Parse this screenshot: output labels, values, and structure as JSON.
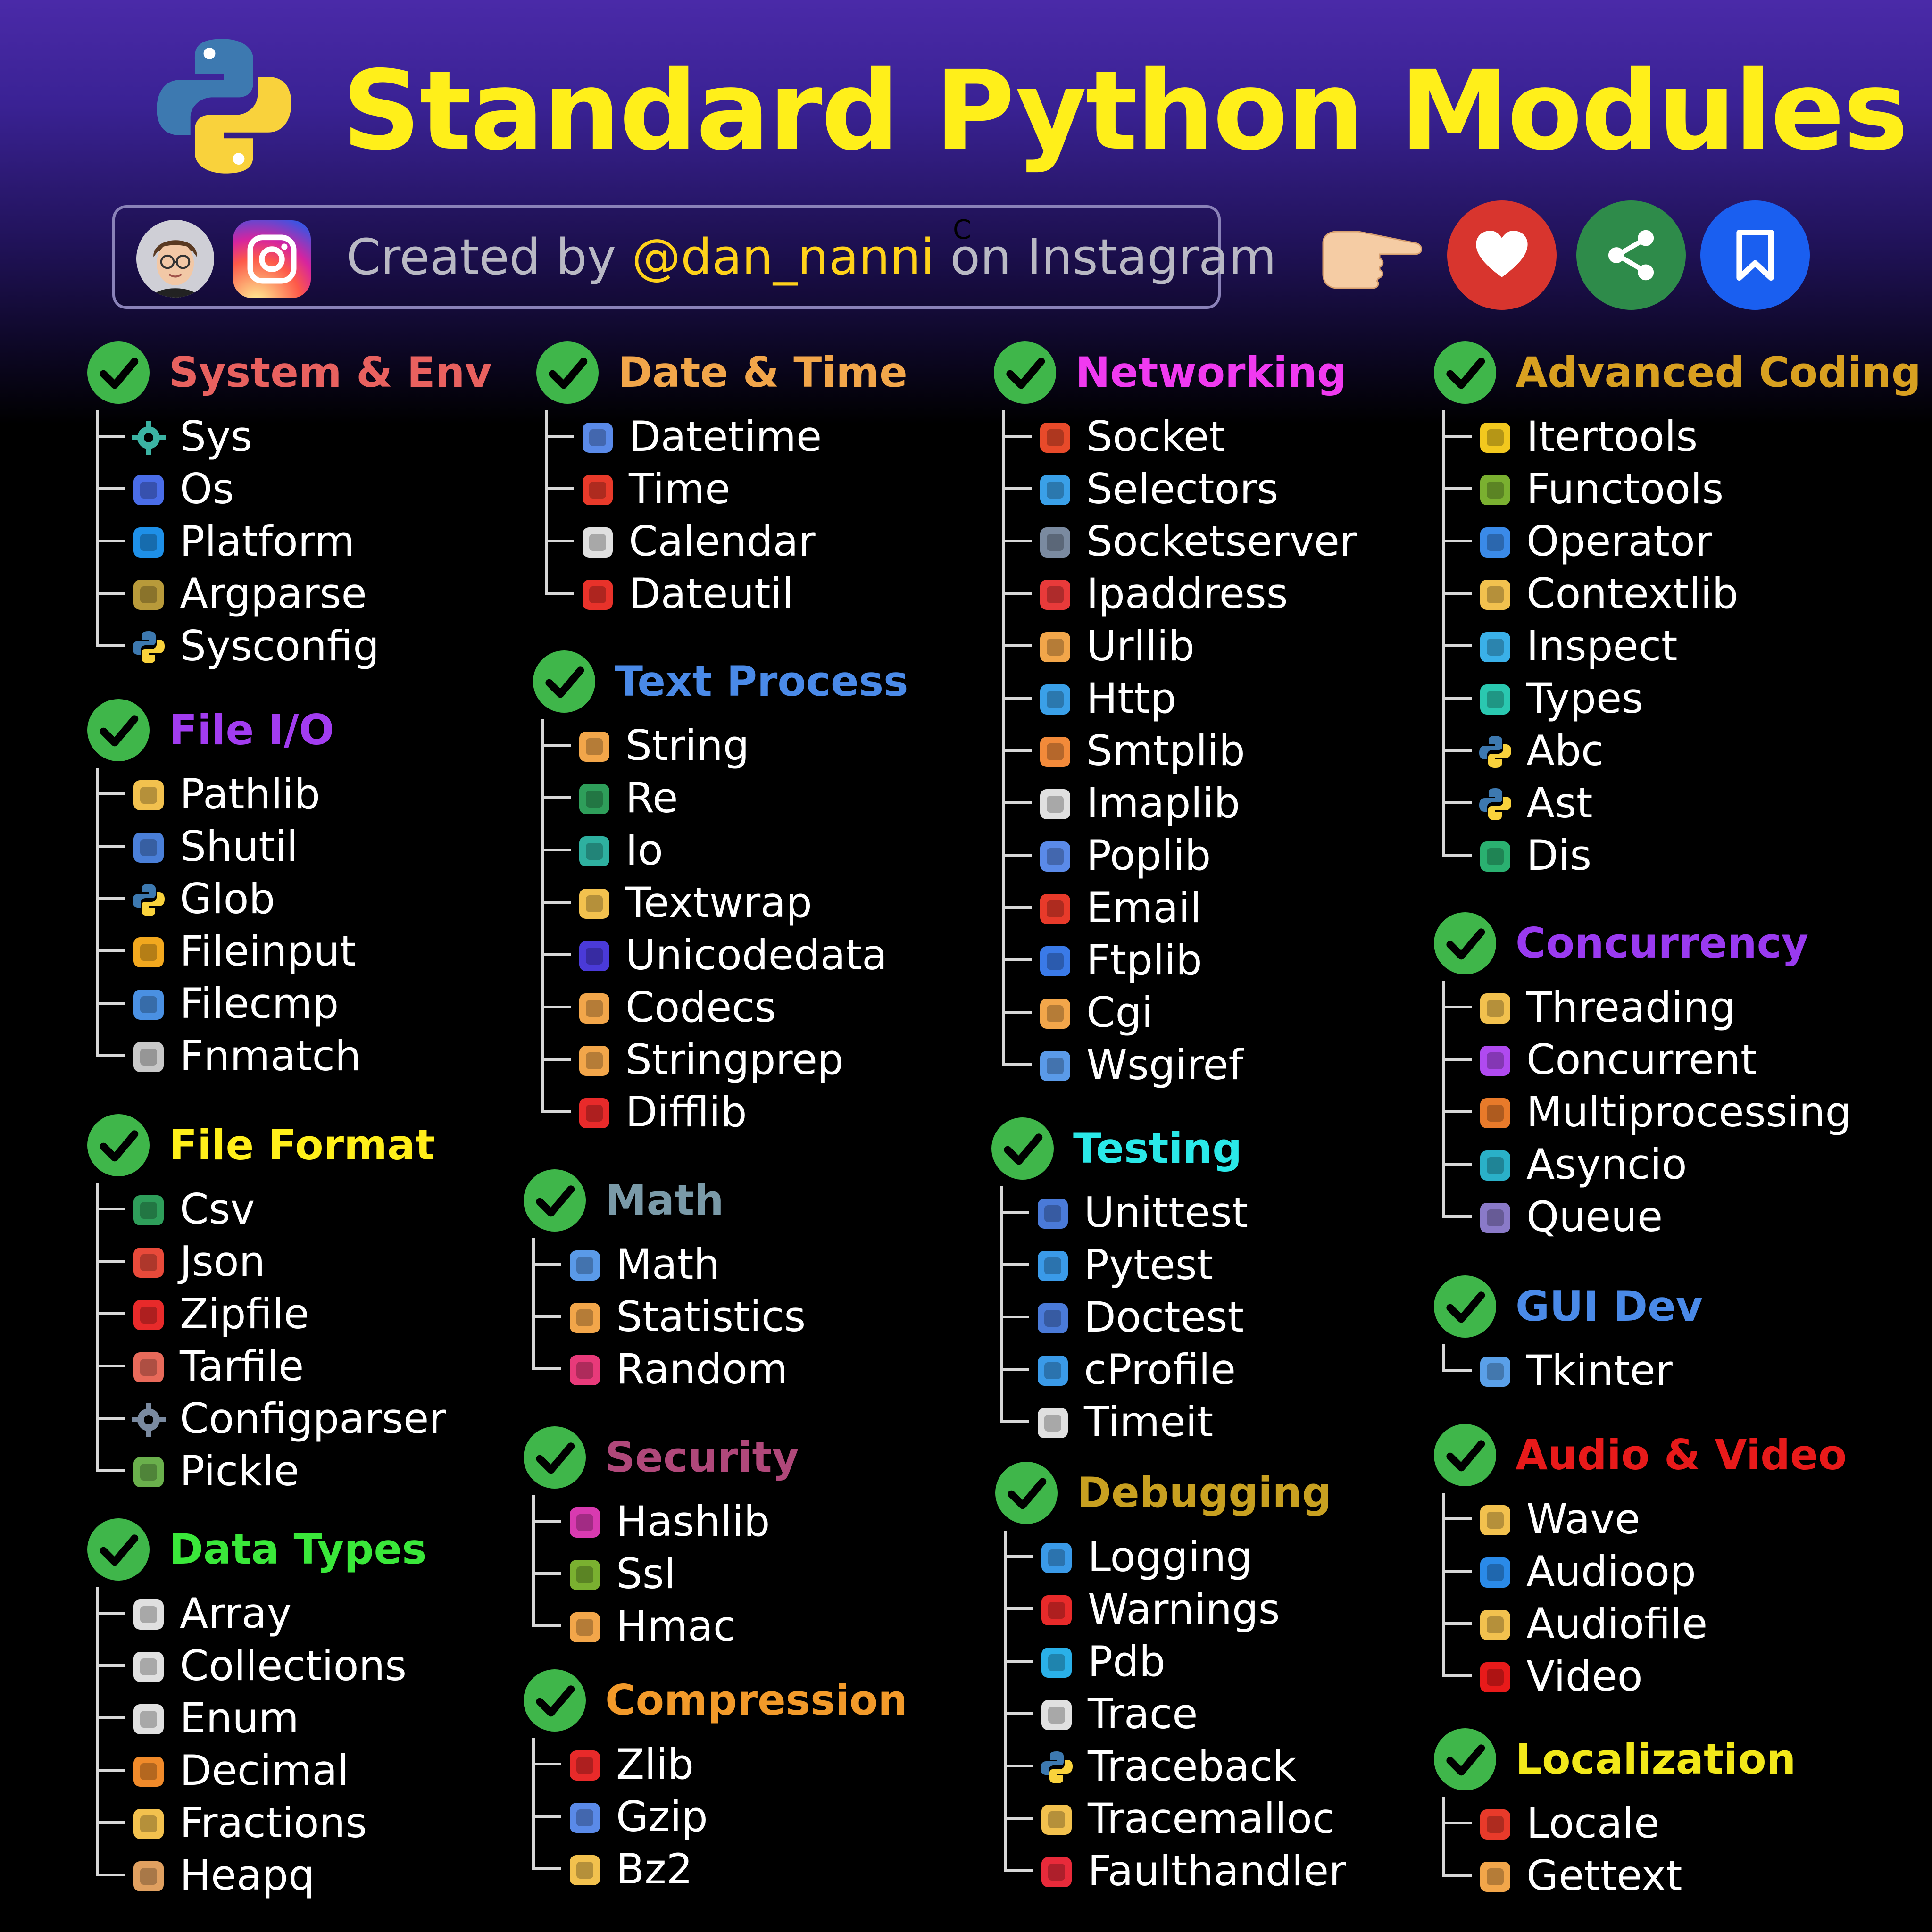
{
  "header": {
    "title": "Standard Python Modules",
    "credit_prefix": "Created by ",
    "credit_handle": "@dan_nanni",
    "credit_suffix": " on Instagram",
    "stray_char": "C"
  },
  "colors": {
    "title": "#ffef1a",
    "handle": "#ffd21a",
    "check": "#3fb64a",
    "heart": "#d8352e",
    "share": "#2e8b4a",
    "bookmark": "#1a5ff0"
  },
  "categories": [
    {
      "title": "System & Env",
      "color": "#e8615f",
      "items": [
        {
          "label": "Sys",
          "icon": "gear-icon",
          "c": "#3bb3a3"
        },
        {
          "label": "Os",
          "icon": "os-gear-icon",
          "c": "#4a6de8"
        },
        {
          "label": "Platform",
          "icon": "platform-icon",
          "c": "#1e90e8"
        },
        {
          "label": "Argparse",
          "icon": "argparse-icon",
          "c": "#b89a3a"
        },
        {
          "label": "Sysconfig",
          "icon": "python-icon",
          "c": "#3d79b0"
        }
      ]
    },
    {
      "title": "File I/O",
      "color": "#a23cf0",
      "items": [
        {
          "label": "Pathlib",
          "icon": "folder-search-icon",
          "c": "#f2c14e"
        },
        {
          "label": "Shutil",
          "icon": "file-copy-icon",
          "c": "#4a7fd8"
        },
        {
          "label": "Glob",
          "icon": "python-icon",
          "c": "#3d79b0"
        },
        {
          "label": "Fileinput",
          "icon": "upload-icon",
          "c": "#f2a81e"
        },
        {
          "label": "Filecmp",
          "icon": "file-compare-icon",
          "c": "#4a90e2"
        },
        {
          "label": "Fnmatch",
          "icon": "file-search-icon",
          "c": "#c8c8c8"
        }
      ]
    },
    {
      "title": "File Format",
      "color": "#ffef1a",
      "items": [
        {
          "label": "Csv",
          "icon": "csv-file-icon",
          "c": "#2e9e5a"
        },
        {
          "label": "Json",
          "icon": "json-file-icon",
          "c": "#e84a3a"
        },
        {
          "label": "Zipfile",
          "icon": "zip-file-icon",
          "c": "#e82a2a"
        },
        {
          "label": "Tarfile",
          "icon": "tar-file-icon",
          "c": "#e86a5a"
        },
        {
          "label": "Configparser",
          "icon": "gear-icon",
          "c": "#7a8aa0"
        },
        {
          "label": "Pickle",
          "icon": "pickle-icon",
          "c": "#6ab04c"
        }
      ]
    },
    {
      "title": "Data Types",
      "color": "#3ae83a",
      "items": [
        {
          "label": "Array",
          "icon": "array-icon",
          "c": "#e0e0e0"
        },
        {
          "label": "Collections",
          "icon": "collections-icon",
          "c": "#e0e0e0"
        },
        {
          "label": "Enum",
          "icon": "list-icon",
          "c": "#e0e0e0"
        },
        {
          "label": "Decimal",
          "icon": "decimal-icon",
          "c": "#f08a2a"
        },
        {
          "label": "Fractions",
          "icon": "pie-chart-icon",
          "c": "#f2c14e"
        },
        {
          "label": "Heapq",
          "icon": "heap-icon",
          "c": "#e0a060"
        }
      ]
    },
    {
      "title": "Date & Time",
      "color": "#f2a64a",
      "items": [
        {
          "label": "Datetime",
          "icon": "calendar-clock-icon",
          "c": "#5a8ae8"
        },
        {
          "label": "Time",
          "icon": "stopwatch-icon",
          "c": "#e83a2a"
        },
        {
          "label": "Calendar",
          "icon": "calendar-icon",
          "c": "#e0e0e0"
        },
        {
          "label": "Dateutil",
          "icon": "calendar-red-icon",
          "c": "#e8322a"
        }
      ]
    },
    {
      "title": "Text Process",
      "color": "#4a8ae8",
      "items": [
        {
          "label": "String",
          "icon": "font-aa-icon",
          "c": "#f2a64a"
        },
        {
          "label": "Re",
          "icon": "regex-icon",
          "c": "#2e9e5a"
        },
        {
          "label": "Io",
          "icon": "arrows-updown-icon",
          "c": "#2eb0a0"
        },
        {
          "label": "Textwrap",
          "icon": "text-wrap-icon",
          "c": "#f2c14e"
        },
        {
          "label": "Unicodedata",
          "icon": "unicode-icon",
          "c": "#4a3ad8"
        },
        {
          "label": "Codecs",
          "icon": "codecs-icon",
          "c": "#f2a64a"
        },
        {
          "label": "Stringprep",
          "icon": "font-aa-icon",
          "c": "#f2a64a"
        },
        {
          "label": "Difflib",
          "icon": "diff-icon",
          "c": "#e82a2a"
        }
      ]
    },
    {
      "title": "Math",
      "color": "#7a9aa8",
      "items": [
        {
          "label": "Math",
          "icon": "calculator-icon",
          "c": "#5a9ae8"
        },
        {
          "label": "Statistics",
          "icon": "bar-chart-icon",
          "c": "#f2a64a"
        },
        {
          "label": "Random",
          "icon": "shuffle-icon",
          "c": "#e83a7a"
        }
      ]
    },
    {
      "title": "Security",
      "color": "#b0487a",
      "items": [
        {
          "label": "Hashlib",
          "icon": "funnel-icon",
          "c": "#d83ab0"
        },
        {
          "label": "Ssl",
          "icon": "ssl-lock-icon",
          "c": "#7ab030"
        },
        {
          "label": "Hmac",
          "icon": "lock-icon",
          "c": "#f2a64a"
        }
      ]
    },
    {
      "title": "Compression",
      "color": "#f29a2a",
      "items": [
        {
          "label": "Zlib",
          "icon": "zip-file-icon",
          "c": "#e82a2a"
        },
        {
          "label": "Gzip",
          "icon": "gzip-file-icon",
          "c": "#5a8ae8"
        },
        {
          "label": "Bz2",
          "icon": "bz2-file-icon",
          "c": "#f2c14e"
        }
      ]
    },
    {
      "title": "Networking",
      "color": "#f03af0",
      "items": [
        {
          "label": "Socket",
          "icon": "socket-icon",
          "c": "#e84a2a"
        },
        {
          "label": "Selectors",
          "icon": "checkbox-icon",
          "c": "#3aa0e8"
        },
        {
          "label": "Socketserver",
          "icon": "server-icon",
          "c": "#7a8aa0"
        },
        {
          "label": "Ipaddress",
          "icon": "ip-pin-icon",
          "c": "#e83a3a"
        },
        {
          "label": "Urllib",
          "icon": "urllib-icon",
          "c": "#f2a64a"
        },
        {
          "label": "Http",
          "icon": "http-globe-icon",
          "c": "#3aa0e8"
        },
        {
          "label": "Smtplib",
          "icon": "smtp-file-icon",
          "c": "#f28a3a"
        },
        {
          "label": "Imaplib",
          "icon": "imap-file-icon",
          "c": "#e0e0e0"
        },
        {
          "label": "Poplib",
          "icon": "pop3-file-icon",
          "c": "#5a8ae8"
        },
        {
          "label": "Email",
          "icon": "gmail-icon",
          "c": "#e83a2a"
        },
        {
          "label": "Ftplib",
          "icon": "ftp-icon",
          "c": "#3a7ae8"
        },
        {
          "label": "Cgi",
          "icon": "cgi-file-icon",
          "c": "#f2a64a"
        },
        {
          "label": "Wsgiref",
          "icon": "dome-server-icon",
          "c": "#5a9ae8"
        }
      ]
    },
    {
      "title": "Testing",
      "color": "#2ae8e8",
      "items": [
        {
          "label": "Unittest",
          "icon": "unittest-icon",
          "c": "#4a7ad8"
        },
        {
          "label": "Pytest",
          "icon": "pytest-icon",
          "c": "#3a9ae8"
        },
        {
          "label": "Doctest",
          "icon": "clipboard-icon",
          "c": "#4a7ad8"
        },
        {
          "label": "cProfile",
          "icon": "target-icon",
          "c": "#3a9ae8"
        },
        {
          "label": "Timeit",
          "icon": "timer-icon",
          "c": "#e0e0e0"
        }
      ]
    },
    {
      "title": "Debugging",
      "color": "#c8a020",
      "items": [
        {
          "label": "Logging",
          "icon": "log-file-icon",
          "c": "#3a9ae8"
        },
        {
          "label": "Warnings",
          "icon": "warning-icon",
          "c": "#e82a2a"
        },
        {
          "label": "Pdb",
          "icon": "magnify-bug-icon",
          "c": "#2ab0e8"
        },
        {
          "label": "Trace",
          "icon": "trace-icon",
          "c": "#e0e0e0"
        },
        {
          "label": "Traceback",
          "icon": "python-icon",
          "c": "#3d79b0"
        },
        {
          "label": "Tracemalloc",
          "icon": "tracemalloc-icon",
          "c": "#f2c14e"
        },
        {
          "label": "Faulthandler",
          "icon": "error-icon",
          "c": "#e82a3a"
        }
      ]
    },
    {
      "title": "Advanced Coding",
      "color": "#d8a020",
      "items": [
        {
          "label": "Itertools",
          "icon": "refresh-icon",
          "c": "#f2c81e"
        },
        {
          "label": "Functools",
          "icon": "function-icon",
          "c": "#7ab030"
        },
        {
          "label": "Operator",
          "icon": "operator-icon",
          "c": "#3a8ae8"
        },
        {
          "label": "Contextlib",
          "icon": "bulb-gear-icon",
          "c": "#f2c14e"
        },
        {
          "label": "Inspect",
          "icon": "inspect-icon",
          "c": "#3ab0e8"
        },
        {
          "label": "Types",
          "icon": "types-icon",
          "c": "#2ac8b0"
        },
        {
          "label": "Abc",
          "icon": "python-icon",
          "c": "#3d79b0"
        },
        {
          "label": "Ast",
          "icon": "python-icon",
          "c": "#3d79b0"
        },
        {
          "label": "Dis",
          "icon": "dis-icon",
          "c": "#2ab070"
        }
      ]
    },
    {
      "title": "Concurrency",
      "color": "#9a3af0",
      "items": [
        {
          "label": "Threading",
          "icon": "threading-icon",
          "c": "#f2c14e"
        },
        {
          "label": "Concurrent",
          "icon": "concurrent-icon",
          "c": "#b04af0"
        },
        {
          "label": "Multiprocessing",
          "icon": "cpu-icon",
          "c": "#e87a2a"
        },
        {
          "label": "Asyncio",
          "icon": "asyncio-icon",
          "c": "#2ab0c8"
        },
        {
          "label": "Queue",
          "icon": "queue-icon",
          "c": "#8a7ac8"
        }
      ]
    },
    {
      "title": "GUI Dev",
      "color": "#4a8ae8",
      "items": [
        {
          "label": "Tkinter",
          "icon": "gui-window-icon",
          "c": "#5aa0e8"
        }
      ]
    },
    {
      "title": "Audio & Video",
      "color": "#e81a1a",
      "items": [
        {
          "label": "Wave",
          "icon": "waveform-icon",
          "c": "#f2c14e"
        },
        {
          "label": "Audioop",
          "icon": "speaker-icon",
          "c": "#2a8ae8"
        },
        {
          "label": "Audiofile",
          "icon": "audio-folder-icon",
          "c": "#f2c14e"
        },
        {
          "label": "Video",
          "icon": "play-icon",
          "c": "#e81a1a"
        }
      ]
    },
    {
      "title": "Localization",
      "color": "#f2e81a",
      "items": [
        {
          "label": "Locale",
          "icon": "location-pin-icon",
          "c": "#e83a2a"
        },
        {
          "label": "Gettext",
          "icon": "text-frame-icon",
          "c": "#f2a64a"
        }
      ]
    }
  ]
}
